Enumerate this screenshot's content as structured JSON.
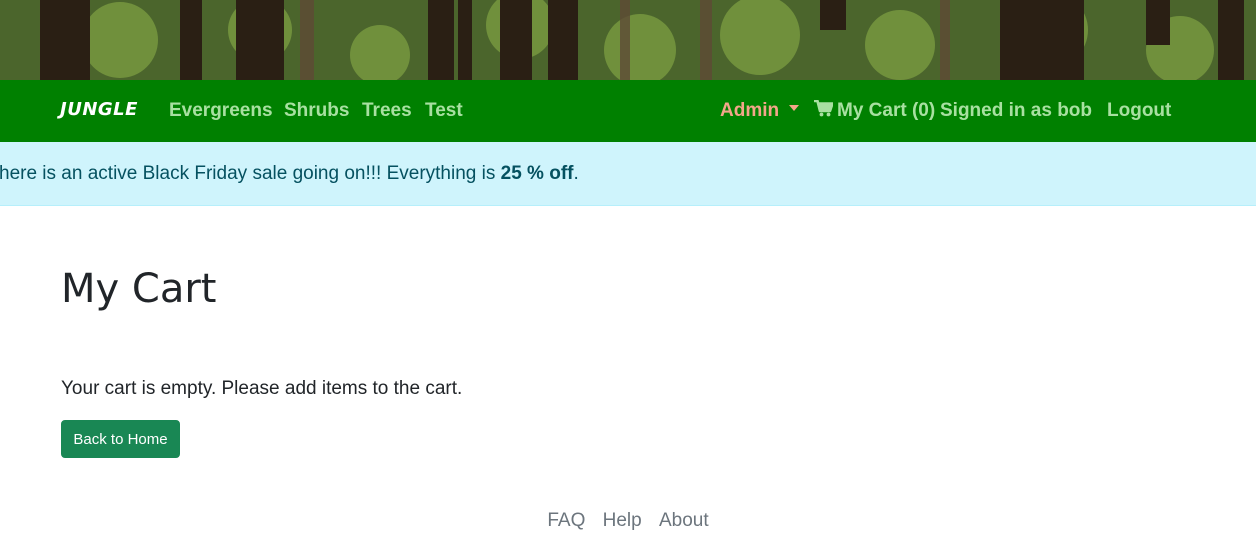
{
  "header": {
    "brand": "JUNGLE",
    "nav": {
      "evergreens": "Evergreens",
      "shrubs": "Shrubs",
      "trees": "Trees",
      "test": "Test",
      "admin": "Admin",
      "cart": "My Cart (0)",
      "signed_in": "Signed in as bob",
      "logout": "Logout"
    },
    "colors": {
      "navbar": "#008000",
      "nav_link": "#a8e0a1",
      "admin": "#f4a68a"
    }
  },
  "banner": {
    "text_before": "here is an active Black Friday sale going on!!! Everything is ",
    "highlight": "25 % off",
    "text_after": ".",
    "color": "#cff4fc"
  },
  "main": {
    "title": "My Cart",
    "empty_message": "Your cart is empty. Please add items to the cart.",
    "home_button": "Back to Home",
    "button_color": "#198754"
  },
  "footer": {
    "links": [
      "FAQ",
      "Help",
      "About"
    ]
  },
  "icons": {
    "cart": "cart-icon",
    "dropdown": "chevron-down-icon"
  }
}
